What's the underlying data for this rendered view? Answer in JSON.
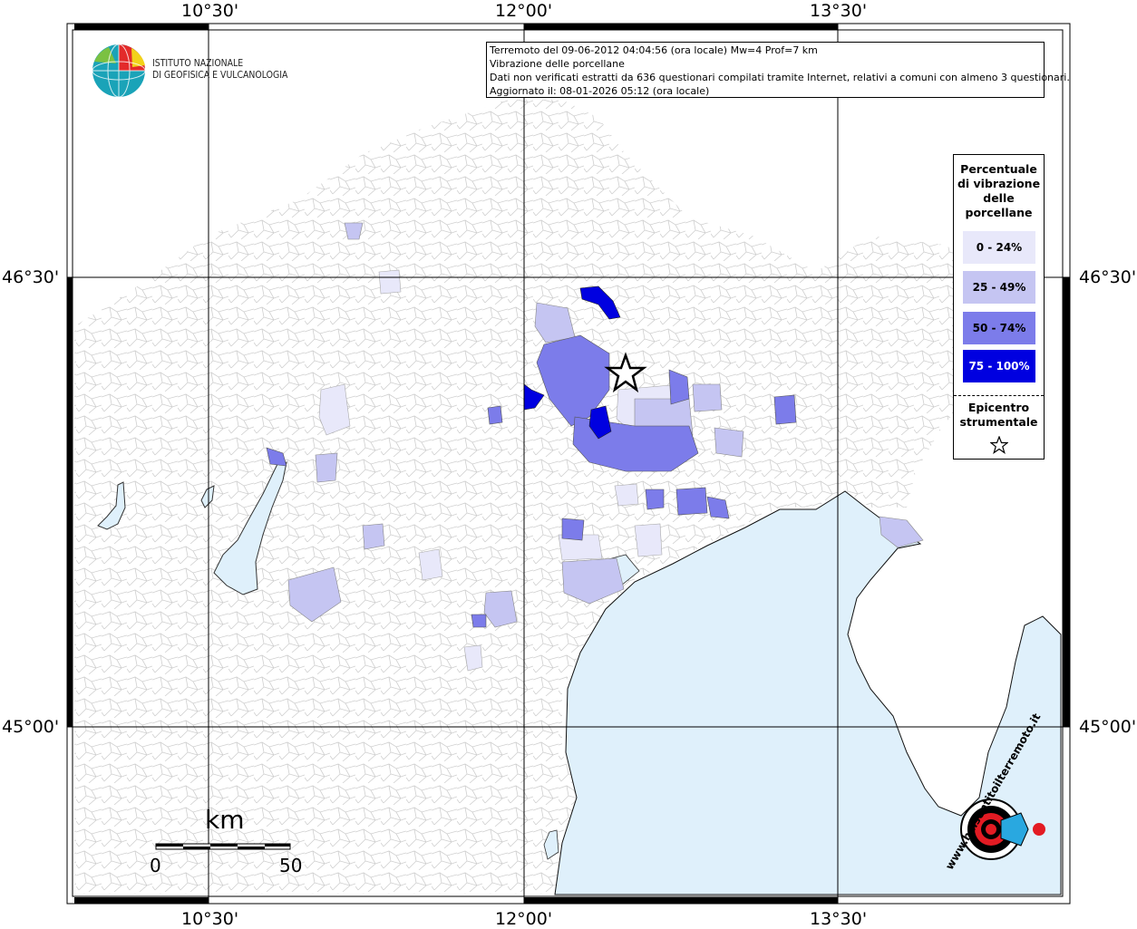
{
  "info": {
    "line1": "Terremoto del 09-06-2012 04:04:56 (ora locale) Mw=4 Prof=7 km",
    "line2": "Vibrazione delle porcellane",
    "line3": "Dati non verificati estratti da 636 questionari compilati tramite Internet, relativi a comuni con almeno 3 questionari.",
    "line4": "Aggiornato il: 08-01-2026 05:12 (ora locale)"
  },
  "logo": {
    "line1": "ISTITUTO NAZIONALE",
    "line2": "DI GEOFISICA E VULCANOLOGIA"
  },
  "axes": {
    "lon_ticks": [
      "10°30'",
      "12°00'",
      "13°30'"
    ],
    "lat_ticks": [
      "46°30'",
      "45°00'"
    ]
  },
  "legend": {
    "title_lines": [
      "Percentuale",
      "di vibrazione",
      "delle",
      "porcellane"
    ],
    "classes": [
      {
        "label": "0 - 24%",
        "color": "#e8e8fa",
        "text_color": "#000000"
      },
      {
        "label": "25 - 49%",
        "color": "#c5c5f2",
        "text_color": "#000000"
      },
      {
        "label": "50 - 74%",
        "color": "#7c7cea",
        "text_color": "#000000"
      },
      {
        "label": "75 - 100%",
        "color": "#0000e0",
        "text_color": "#ffffff"
      }
    ],
    "epicenter_lines": [
      "Epicentro",
      "strumentale"
    ]
  },
  "scale": {
    "unit": "km",
    "start": "0",
    "end": "50"
  },
  "watermark": {
    "text": "www.haisentitoilterremoto.it"
  },
  "colors": {
    "sea": "#dff0fb",
    "land": "#ffffff",
    "border_lines": "#c8c8c8"
  }
}
